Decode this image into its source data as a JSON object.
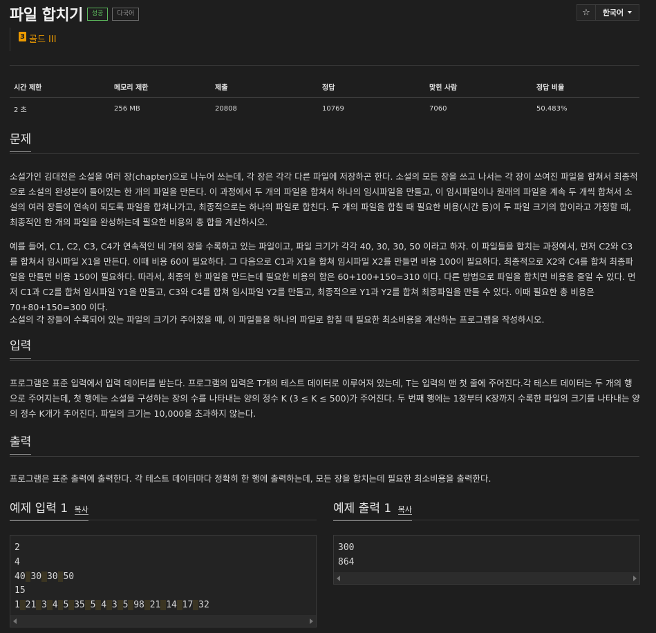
{
  "title": "파일 합치기",
  "badges": {
    "success": "성공",
    "multilang": "다국어"
  },
  "topbar": {
    "star": "☆",
    "language": "한국어"
  },
  "tier": {
    "number": "3",
    "label": "골드 III"
  },
  "stats": {
    "headers": [
      "시간 제한",
      "메모리 제한",
      "제출",
      "정답",
      "맞힌 사람",
      "정답 비율"
    ],
    "values": [
      "2 초",
      "256 MB",
      "20808",
      "10769",
      "7060",
      "50.483%"
    ]
  },
  "sections": {
    "problem": {
      "title": "문제",
      "paragraphs": [
        "소설가인 김대전은 소설을 여러 장(chapter)으로 나누어 쓰는데, 각 장은 각각 다른 파일에 저장하곤 한다. 소설의 모든 장을 쓰고 나서는 각 장이 쓰여진 파일을 합쳐서 최종적으로 소설의 완성본이 들어있는 한 개의 파일을 만든다. 이 과정에서 두 개의 파일을 합쳐서 하나의 임시파일을 만들고, 이 임시파일이나 원래의 파일을 계속 두 개씩 합쳐서 소설의 여러 장들이 연속이 되도록 파일을 합쳐나가고, 최종적으로는 하나의 파일로 합친다. 두 개의 파일을 합칠 때 필요한 비용(시간 등)이 두 파일 크기의 합이라고 가정할 때, 최종적인 한 개의 파일을 완성하는데 필요한 비용의 총 합을 계산하시오.",
        "예를 들어, C1, C2, C3, C4가 연속적인 네 개의 장을 수록하고 있는 파일이고, 파일 크기가 각각 40, 30, 30, 50 이라고 하자. 이 파일들을 합치는 과정에서, 먼저 C2와 C3를 합쳐서 임시파일 X1을 만든다. 이때 비용 60이 필요하다. 그 다음으로 C1과 X1을 합쳐 임시파일 X2를 만들면 비용 100이 필요하다. 최종적으로 X2와 C4를 합쳐 최종파일을 만들면 비용 150이 필요하다. 따라서, 최종의 한 파일을 만드는데 필요한 비용의 합은 60+100+150=310 이다. 다른 방법으로 파일을 합치면 비용을 줄일 수 있다. 먼저 C1과 C2를 합쳐 임시파일 Y1을 만들고, C3와 C4를 합쳐 임시파일 Y2를 만들고, 최종적으로 Y1과 Y2를 합쳐 최종파일을 만들 수 있다. 이때 필요한 총 비용은 70+80+150=300 이다.",
        "소설의 각 장들이 수록되어 있는 파일의 크기가 주어졌을 때, 이 파일들을 하나의 파일로 합칠 때 필요한 최소비용을 계산하는 프로그램을 작성하시오."
      ]
    },
    "input": {
      "title": "입력",
      "paragraph": "프로그램은 표준 입력에서 입력 데이터를 받는다. 프로그램의 입력은 T개의 테스트 데이터로 이루어져 있는데, T는 입력의 맨 첫 줄에 주어진다.각 테스트 데이터는 두 개의 행으로 주어지는데, 첫 행에는 소설을 구성하는 장의 수를 나타내는 양의 정수 K (3 ≤ K ≤ 500)가 주어진다. 두 번째 행에는 1장부터 K장까지 수록한 파일의 크기를 나타내는 양의 정수 K개가 주어진다. 파일의 크기는 10,000을 초과하지 않는다."
    },
    "output": {
      "title": "출력",
      "paragraph": "프로그램은 표준 출력에 출력한다. 각 테스트 데이터마다 정확히 한 행에 출력하는데, 모든 장을 합치는데 필요한 최소비용을 출력한다."
    }
  },
  "samples": {
    "copy_label": "복사",
    "input_title": "예제 입력 1",
    "output_title": "예제 출력 1",
    "input_lines": [
      "2",
      "4",
      "40 30 30 50",
      "15",
      "1 21 3 4 5 35 5 4 3 5 98 21 14 17 32"
    ],
    "output_lines": [
      "300",
      "864"
    ]
  }
}
